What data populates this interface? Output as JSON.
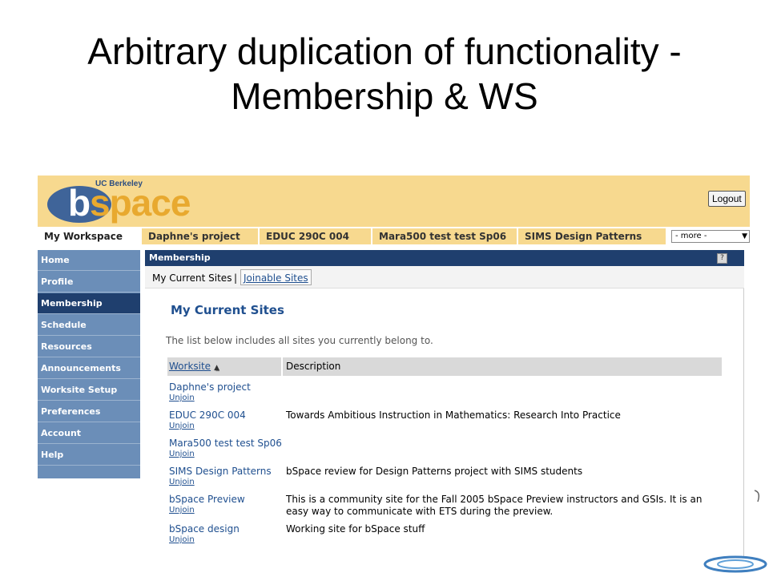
{
  "slide": {
    "title_line1": "Arbitrary duplication of functionality -",
    "title_line2": "Membership & WS"
  },
  "banner": {
    "logo_org": "UC Berkeley",
    "logo_b": "b",
    "logo_space": "space",
    "logout_label": "Logout"
  },
  "tabs": [
    {
      "label": "My Workspace",
      "active": true
    },
    {
      "label": "Daphne's project"
    },
    {
      "label": "EDUC 290C 004"
    },
    {
      "label": "Mara500 test test Sp06"
    },
    {
      "label": "SIMS Design Patterns"
    }
  ],
  "more_select": {
    "value": "- more -"
  },
  "sidenav": {
    "items": [
      {
        "label": "Home"
      },
      {
        "label": "Profile"
      },
      {
        "label": "Membership",
        "active": true
      },
      {
        "label": "Schedule"
      },
      {
        "label": "Resources"
      },
      {
        "label": "Announcements"
      },
      {
        "label": "Worksite Setup"
      },
      {
        "label": "Preferences"
      },
      {
        "label": "Account"
      },
      {
        "label": "Help"
      }
    ]
  },
  "tool": {
    "header": "Membership",
    "help_icon_label": "?",
    "tabs": {
      "current": "My Current Sites",
      "separator": "|",
      "joinable": "Joinable Sites"
    },
    "heading": "My Current Sites",
    "intro": "The list below includes all sites you currently belong to.",
    "table": {
      "col_worksite": "Worksite",
      "col_description": "Description",
      "rows": [
        {
          "name": "Daphne's project",
          "unjoin": "Unjoin",
          "description": ""
        },
        {
          "name": "EDUC 290C 004",
          "unjoin": "Unjoin",
          "description": "Towards Ambitious Instruction in Mathematics: Research Into Practice"
        },
        {
          "name": "Mara500 test test Sp06",
          "unjoin": "Unjoin",
          "description": ""
        },
        {
          "name": "SIMS Design Patterns",
          "unjoin": "Unjoin",
          "description": "bSpace review for Design Patterns project with SIMS students"
        },
        {
          "name": "bSpace Preview",
          "unjoin": "Unjoin",
          "description": "This is a community site for the Fall 2005 bSpace Preview instructors and GSIs. It is an easy way to communicate with ETS during the preview."
        },
        {
          "name": "bSpace design",
          "unjoin": "Unjoin",
          "description": "Working site for bSpace stuff"
        }
      ]
    }
  },
  "colors": {
    "banner": "#f7d98f",
    "nav": "#6b8eb8",
    "nav_active": "#1f3f6e",
    "link": "#1f4f8f"
  }
}
